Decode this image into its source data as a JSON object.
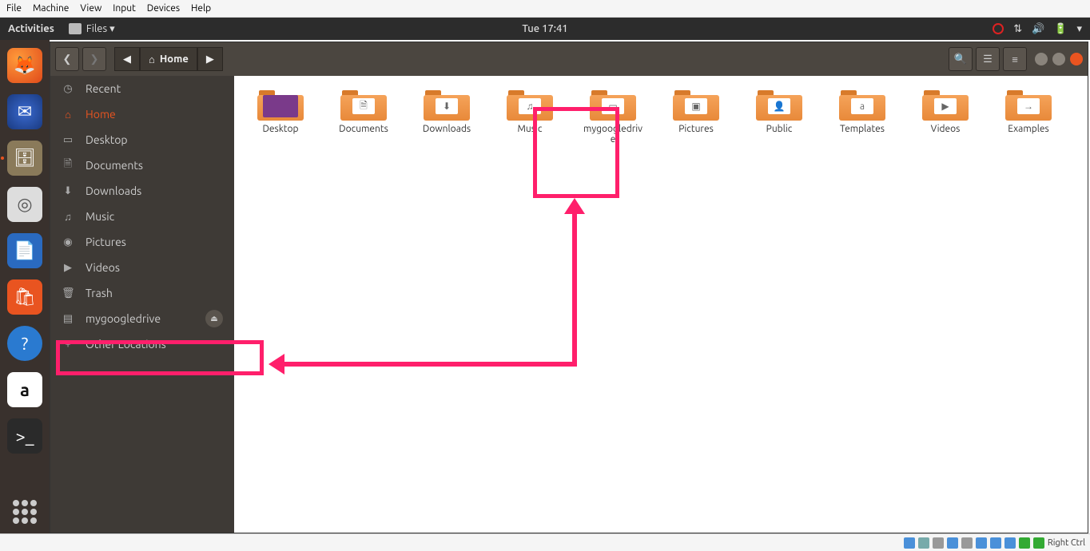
{
  "vm_menu": [
    "File",
    "Machine",
    "View",
    "Input",
    "Devices",
    "Help"
  ],
  "top_panel": {
    "activities": "Activities",
    "app_label": "Files ▾",
    "clock": "Tue 17:41"
  },
  "titlebar": {
    "home_label": "Home"
  },
  "sidebar": {
    "items": [
      {
        "icon": "◷",
        "label": "Recent"
      },
      {
        "icon": "⌂",
        "label": "Home",
        "active": true
      },
      {
        "icon": "▭",
        "label": "Desktop"
      },
      {
        "icon": "🗎",
        "label": "Documents"
      },
      {
        "icon": "⬇",
        "label": "Downloads"
      },
      {
        "icon": "♫",
        "label": "Music"
      },
      {
        "icon": "◉",
        "label": "Pictures"
      },
      {
        "icon": "▶",
        "label": "Videos"
      },
      {
        "icon": "🗑",
        "label": "Trash"
      },
      {
        "icon": "▤",
        "label": "mygoogledrive",
        "eject": true
      },
      {
        "icon": "+",
        "label": "Other Locations"
      }
    ]
  },
  "folders": [
    {
      "label": "Desktop",
      "emblem": "",
      "cls": "desktop"
    },
    {
      "label": "Documents",
      "emblem": "🗎"
    },
    {
      "label": "Downloads",
      "emblem": "⬇"
    },
    {
      "label": "Music",
      "emblem": "♫"
    },
    {
      "label": "mygoogledrive",
      "emblem": "▭",
      "highlighted": true,
      "wrap": true
    },
    {
      "label": "Pictures",
      "emblem": "▣"
    },
    {
      "label": "Public",
      "emblem": "👤"
    },
    {
      "label": "Templates",
      "emblem": "a"
    },
    {
      "label": "Videos",
      "emblem": "▶"
    },
    {
      "label": "Examples",
      "emblem": "→"
    }
  ],
  "vm_status": {
    "label": "Right Ctrl"
  }
}
